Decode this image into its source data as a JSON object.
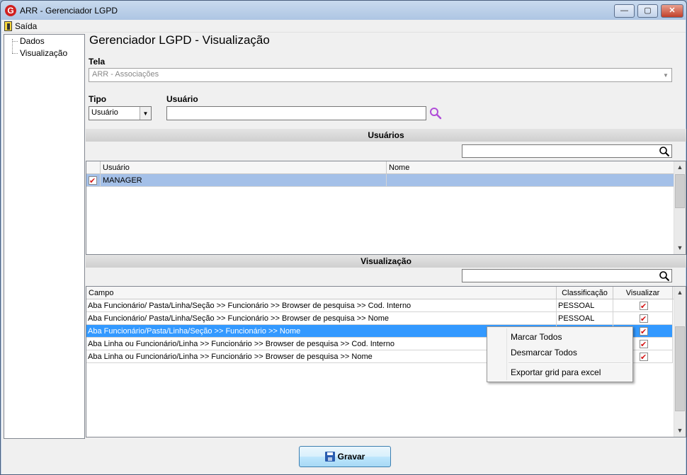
{
  "window": {
    "title": "ARR - Gerenciador LGPD",
    "logo_letter": "G",
    "controls": {
      "minimize": "—",
      "maximize": "▢",
      "close": "✕"
    }
  },
  "menu": {
    "exit_label": "Saída"
  },
  "tree": {
    "items": [
      {
        "label": "Dados"
      },
      {
        "label": "Visualização"
      }
    ]
  },
  "page": {
    "title": "Gerenciador LGPD - Visualização",
    "tela_label": "Tela",
    "tela_value": "ARR - Associações",
    "tipo_label": "Tipo",
    "tipo_value": "Usuário",
    "usuario_label": "Usuário",
    "usuario_value": ""
  },
  "users_section": {
    "title": "Usuários",
    "filter_value": "",
    "columns": [
      "Usuário",
      "Nome"
    ],
    "rows": [
      {
        "checked": true,
        "usuario": "MANAGER",
        "nome": ""
      }
    ]
  },
  "view_section": {
    "title": "Visualização",
    "filter_value": "",
    "columns": [
      "Campo",
      "Classificação",
      "Visualizar"
    ],
    "rows": [
      {
        "campo": "Aba Funcionário/ Pasta/Linha/Seção >> Funcionário >> Browser de pesquisa >> Cod. Interno",
        "classificacao": "PESSOAL",
        "visualizar": true
      },
      {
        "campo": "Aba Funcionário/ Pasta/Linha/Seção >> Funcionário >> Browser de pesquisa >> Nome",
        "classificacao": "PESSOAL",
        "visualizar": true
      },
      {
        "campo": "Aba Funcionário/Pasta/Linha/Seção >> Funcionário >> Nome",
        "classificacao": "",
        "visualizar": true
      },
      {
        "campo": "Aba Linha ou Funcionário/Linha >> Funcionário >> Browser de pesquisa >> Cod. Interno",
        "classificacao": "",
        "visualizar": true
      },
      {
        "campo": "Aba Linha ou Funcionário/Linha >> Funcionário >> Browser de pesquisa >> Nome",
        "classificacao": "",
        "visualizar": true
      }
    ]
  },
  "context_menu": {
    "items": [
      "Marcar Todos",
      "Desmarcar Todos",
      "Exportar grid para excel"
    ]
  },
  "footer": {
    "save_label": "Gravar"
  },
  "colors": {
    "selection": "#3399ff",
    "manager_row": "#a4c0e8",
    "check_mark": "#d31616",
    "search_purple": "#b04cd8"
  }
}
